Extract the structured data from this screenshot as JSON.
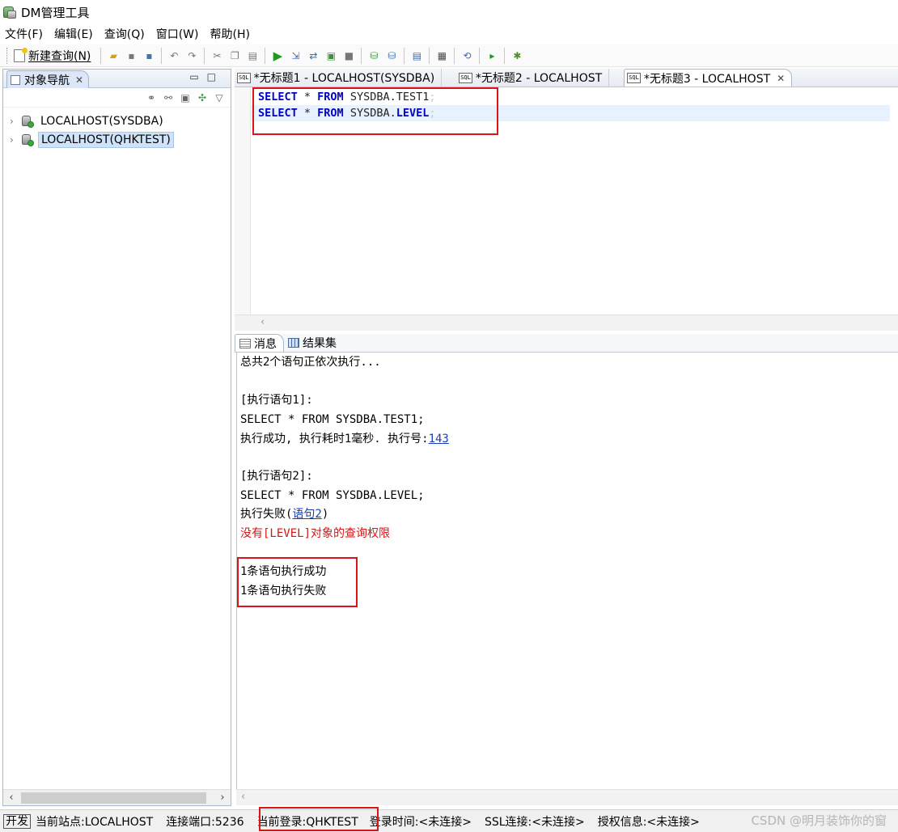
{
  "window": {
    "title": "DM管理工具"
  },
  "menu": [
    "文件(F)",
    "编辑(E)",
    "查询(Q)",
    "窗口(W)",
    "帮助(H)"
  ],
  "toolbar": {
    "new_query_label": "新建查询(N)"
  },
  "navigator": {
    "tab_label": "对象导航",
    "nodes": [
      {
        "label": "LOCALHOST(SYSDBA)",
        "selected": false
      },
      {
        "label": "LOCALHOST(QHKTEST)",
        "selected": true
      }
    ]
  },
  "editor_tabs": [
    {
      "label": "*无标题1 - LOCALHOST(SYSDBA)",
      "active": false
    },
    {
      "label": "*无标题2 - LOCALHOST",
      "active": false
    },
    {
      "label": "*无标题3 - LOCALHOST",
      "active": true
    }
  ],
  "editor": {
    "lines": [
      {
        "kw1": "SELECT",
        "star": " * ",
        "kw2": "FROM",
        "ident": " SYSDBA.TEST1",
        "end": ";"
      },
      {
        "kw1": "SELECT",
        "star": " * ",
        "kw2": "FROM",
        "ident": " SYSDBA.",
        "ident_kw": "LEVEL",
        "end": ";"
      }
    ]
  },
  "result_tabs": [
    "消息",
    "结果集"
  ],
  "messages": {
    "header": "总共2个语句正依次执行...",
    "stmt1_label": "[执行语句1]:",
    "stmt1_sql": "SELECT * FROM SYSDBA.TEST1;",
    "stmt1_result_prefix": "执行成功, 执行耗时1毫秒. 执行号:",
    "stmt1_exec_no": "143",
    "stmt2_label": "[执行语句2]:",
    "stmt2_sql": "SELECT * FROM SYSDBA.LEVEL;",
    "stmt2_result_prefix": "执行失败(",
    "stmt2_link": "语句2",
    "stmt2_result_suffix": ")",
    "stmt2_error": "没有[LEVEL]对象的查询权限",
    "summary_success": "1条语句执行成功",
    "summary_fail": "1条语句执行失败"
  },
  "status": {
    "mode": "开发",
    "site": "当前站点:LOCALHOST",
    "port": "连接端口:5236",
    "login": "当前登录:QHKTEST",
    "login_time": "登录时间:<未连接>",
    "ssl": "SSL连接:<未连接>",
    "license": "授权信息:<未连接>"
  },
  "watermark": "CSDN @明月装饰你的窗",
  "colors": {
    "keyword": "#0000c8",
    "error": "#d61515",
    "highlight_box": "#d9141b",
    "selection": "#cfe3f8"
  }
}
